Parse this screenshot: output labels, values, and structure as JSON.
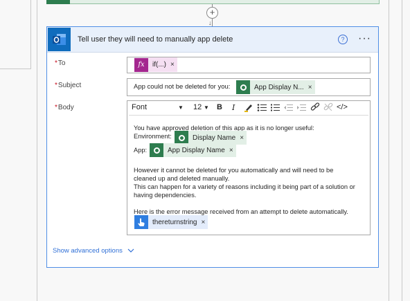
{
  "card": {
    "title": "Tell user they will need to manually app delete",
    "help_label": "?",
    "more_label": "···"
  },
  "fields": {
    "to": {
      "label": "To",
      "token": {
        "icon": "fx",
        "text": "if(...)"
      }
    },
    "subject": {
      "label": "Subject",
      "text": "App could not be deleted for you:",
      "token": {
        "text": "App Display N..."
      }
    },
    "body": {
      "label": "Body"
    }
  },
  "toolbar": {
    "font": "Font",
    "size": "12",
    "bold": "B",
    "italic": "I",
    "code": "</>"
  },
  "body": {
    "line1": "You have approved deletion of this app as it is no longer useful:",
    "env_label": "Environment:",
    "env_token": "Display Name",
    "app_label": "App:",
    "app_token": "App Display Name",
    "para2_line1": "However it cannot be deleted for you automatically and will need to be",
    "para2_line2": "cleaned up and deleted manually.",
    "para2_line3": "This can happen for a variety of reasons including it being part of a solution or",
    "para2_line4": "having dependencies.",
    "para3_line1": "Here is the error message received from an attempt to delete automatically.",
    "error_token": "thereturnstring"
  },
  "token_remove": "×",
  "advanced": "Show advanced options",
  "add_step": "+"
}
